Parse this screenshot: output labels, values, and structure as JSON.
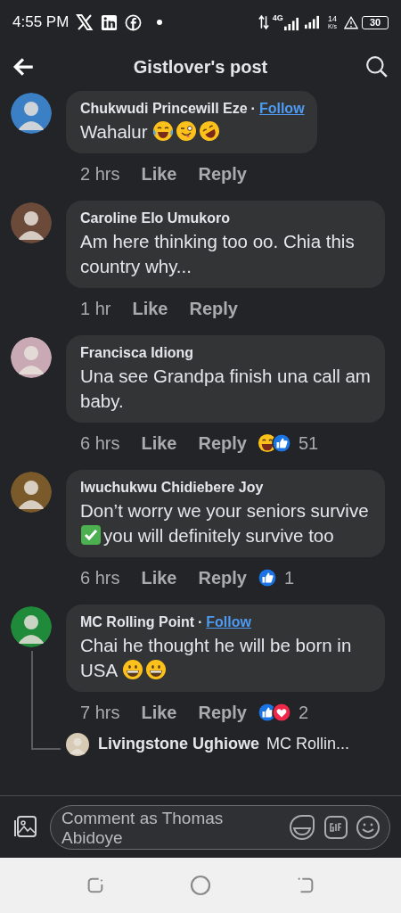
{
  "status_bar": {
    "time": "4:55 PM",
    "network": "4G",
    "speed": "14",
    "speed_unit": "K/s",
    "battery": "30"
  },
  "header": {
    "title": "Gistlover's post"
  },
  "comments": [
    {
      "author": "Chukwudi Princewill Eze",
      "separator": "·",
      "follow": "Follow",
      "color": "#3b7fc4",
      "body": [
        {
          "kind": "text",
          "text": "Wahalur "
        },
        {
          "kind": "tears"
        },
        {
          "kind": "wink"
        },
        {
          "kind": "rofl"
        }
      ],
      "time": "2 hrs",
      "like": "Like",
      "reply": "Reply"
    },
    {
      "author": "Caroline Elo Umukoro",
      "color": "#6b4a3a",
      "body": [
        {
          "kind": "text",
          "text": "Am here thinking too oo. Chia this country why..."
        }
      ],
      "time": "1 hr",
      "like": "Like",
      "reply": "Reply"
    },
    {
      "author": "Francisca Idiong",
      "color": "#c9a9b3",
      "body": [
        {
          "kind": "text",
          "text": "Una see Grandpa finish una call am baby."
        }
      ],
      "time": "6 hrs",
      "like": "Like",
      "reply": "Reply",
      "reactions": [
        {
          "kind": "haha"
        },
        {
          "kind": "like"
        }
      ],
      "reaction_count": "51"
    },
    {
      "author": "Iwuchukwu Chidiebere Joy",
      "color": "#7a5a2a",
      "body": [
        {
          "kind": "text",
          "text": "Don’t worry we your seniors survive"
        },
        {
          "kind": "check"
        },
        {
          "kind": "text",
          "text": "you will definitely survive too"
        }
      ],
      "time": "6 hrs",
      "like": "Like",
      "reply": "Reply",
      "reactions": [
        {
          "kind": "like"
        }
      ],
      "reaction_count": "1"
    },
    {
      "author": "MC Rolling Point",
      "separator": "·",
      "follow": "Follow",
      "color": "#1f8a3a",
      "body": [
        {
          "kind": "text",
          "text": "Chai he thought he will be born in USA "
        },
        {
          "kind": "grin"
        },
        {
          "kind": "grin"
        }
      ],
      "time": "7 hrs",
      "like": "Like",
      "reply": "Reply",
      "reactions": [
        {
          "kind": "like"
        },
        {
          "kind": "love"
        }
      ],
      "reaction_count": "2",
      "replies": [
        {
          "author": "Livingstone Ughiowe",
          "color": "#d8cbb5",
          "text": "MC Rollin..."
        }
      ]
    }
  ],
  "composer": {
    "placeholder": "Comment as Thomas Abidoye"
  }
}
